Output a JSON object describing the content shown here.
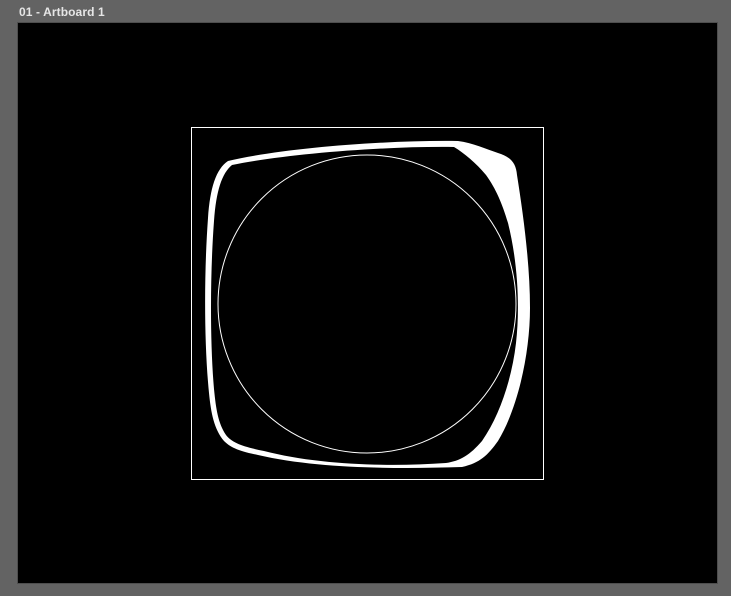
{
  "artboard": {
    "label": "01 - Artboard 1",
    "background_color": "#000000"
  },
  "workspace": {
    "background_color": "#636363"
  },
  "artwork": {
    "stroke_color": "#ffffff",
    "fill_color": "#ffffff",
    "shapes": [
      "bounding-rectangle",
      "distorted-rounded-square",
      "inner-circle"
    ]
  }
}
